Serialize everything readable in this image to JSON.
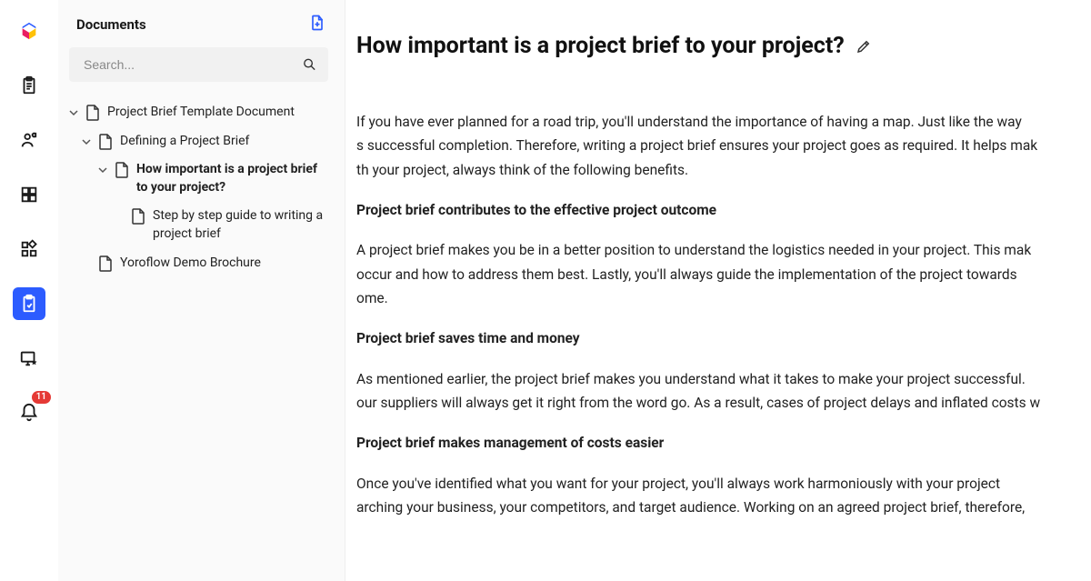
{
  "sidebar": {
    "title": "Documents",
    "searchPlaceholder": "Search..."
  },
  "notifications": {
    "count": "11"
  },
  "tree": {
    "item0": "Project Brief Template Document",
    "item1": "Defining a Project Brief",
    "item2": "How important is a project brief to your project?",
    "item3": "Step by step guide to writing a project brief",
    "item4": "Yoroflow Demo Brochure"
  },
  "page": {
    "title": "How important is a project brief to your project?",
    "para1a": "If you have ever planned for a road trip, you'll understand the importance of having a map. Just like the way",
    "para1b": "s successful completion. Therefore, writing a project brief ensures your project goes as required. It helps mak",
    "para1c": "th your project, always think of the following benefits.",
    "h1": "Project brief contributes to the effective project outcome",
    "para2a": "A project brief makes you be in a better position to understand the logistics needed in your project. This mak",
    "para2b": "occur and how to address them best. Lastly, you'll always guide the implementation of the project towards ",
    "para2c": "ome.",
    "h2": "Project brief saves time and money",
    "para3a": "As mentioned earlier, the project brief makes you understand what it takes to make your project successful. ",
    "para3b": "our suppliers will always get it right from the word go. As a result, cases of project delays and inflated costs w",
    "h3": "Project brief makes management of costs easier",
    "para4a": "Once you've identified what you want for your project, you'll always work harmoniously with your project ",
    "para4b": "arching your business, your competitors, and target audience. Working on an agreed project brief, therefore,"
  }
}
